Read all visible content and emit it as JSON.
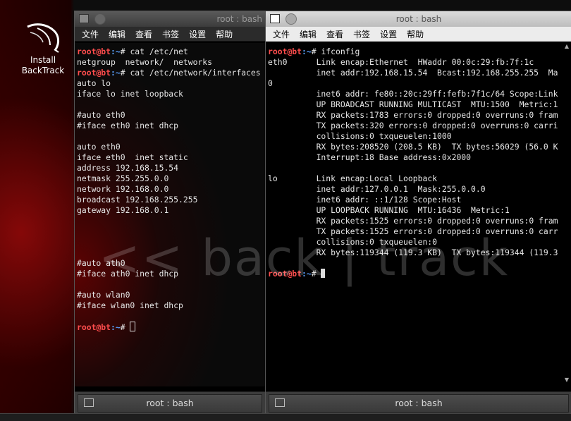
{
  "desktop": {
    "icon_label_1": "Install",
    "icon_label_2": "BackTrack",
    "watermark": "<< back | track"
  },
  "left_terminal": {
    "title": "root : bash",
    "menu": [
      "文件",
      "编辑",
      "查看",
      "书签",
      "设置",
      "帮助"
    ],
    "tab_label": "root : bash",
    "prompt_user": "root",
    "prompt_host": "@bt",
    "prompt_path": ":~",
    "prompt_symbol": "# ",
    "lines": [
      {
        "type": "prompt",
        "cmd": "cat /etc/net"
      },
      {
        "type": "out",
        "text": "netgroup  network/  networks"
      },
      {
        "type": "prompt",
        "cmd": "cat /etc/network/interfaces"
      },
      {
        "type": "out",
        "text": "auto lo"
      },
      {
        "type": "out",
        "text": "iface lo inet loopback"
      },
      {
        "type": "out",
        "text": ""
      },
      {
        "type": "out",
        "text": "#auto eth0"
      },
      {
        "type": "out",
        "text": "#iface eth0 inet dhcp"
      },
      {
        "type": "out",
        "text": ""
      },
      {
        "type": "out",
        "text": "auto eth0"
      },
      {
        "type": "out",
        "text": "iface eth0  inet static"
      },
      {
        "type": "out",
        "text": "address 192.168.15.54"
      },
      {
        "type": "out",
        "text": "netmask 255.255.0.0"
      },
      {
        "type": "out",
        "text": "network 192.168.0.0"
      },
      {
        "type": "out",
        "text": "broadcast 192.168.255.255"
      },
      {
        "type": "out",
        "text": "gateway 192.168.0.1"
      },
      {
        "type": "out",
        "text": ""
      },
      {
        "type": "out",
        "text": ""
      },
      {
        "type": "out",
        "text": ""
      },
      {
        "type": "out",
        "text": ""
      },
      {
        "type": "out",
        "text": "#auto ath0"
      },
      {
        "type": "out",
        "text": "#iface ath0 inet dhcp"
      },
      {
        "type": "out",
        "text": ""
      },
      {
        "type": "out",
        "text": "#auto wlan0"
      },
      {
        "type": "out",
        "text": "#iface wlan0 inet dhcp"
      },
      {
        "type": "out",
        "text": ""
      },
      {
        "type": "prompt_cursor",
        "cmd": ""
      }
    ]
  },
  "right_terminal": {
    "title": "root : bash",
    "menu": [
      "文件",
      "编辑",
      "查看",
      "书签",
      "设置",
      "帮助"
    ],
    "tab_label": "root : bash",
    "prompt_user": "root",
    "prompt_host": "@bt",
    "prompt_path": ":~",
    "prompt_symbol": "# ",
    "lines": [
      {
        "type": "prompt",
        "cmd": "ifconfig"
      },
      {
        "type": "out",
        "text": "eth0      Link encap:Ethernet  HWaddr 00:0c:29:fb:7f:1c"
      },
      {
        "type": "out",
        "text": "          inet addr:192.168.15.54  Bcast:192.168.255.255  Ma"
      },
      {
        "type": "out",
        "text": "0"
      },
      {
        "type": "out",
        "text": "          inet6 addr: fe80::20c:29ff:fefb:7f1c/64 Scope:Link"
      },
      {
        "type": "out",
        "text": "          UP BROADCAST RUNNING MULTICAST  MTU:1500  Metric:1"
      },
      {
        "type": "out",
        "text": "          RX packets:1783 errors:0 dropped:0 overruns:0 fram"
      },
      {
        "type": "out",
        "text": "          TX packets:320 errors:0 dropped:0 overruns:0 carri"
      },
      {
        "type": "out",
        "text": "          collisions:0 txqueuelen:1000"
      },
      {
        "type": "out",
        "text": "          RX bytes:208520 (208.5 KB)  TX bytes:56029 (56.0 K"
      },
      {
        "type": "out",
        "text": "          Interrupt:18 Base address:0x2000"
      },
      {
        "type": "out",
        "text": ""
      },
      {
        "type": "out",
        "text": "lo        Link encap:Local Loopback"
      },
      {
        "type": "out",
        "text": "          inet addr:127.0.0.1  Mask:255.0.0.0"
      },
      {
        "type": "out",
        "text": "          inet6 addr: ::1/128 Scope:Host"
      },
      {
        "type": "out",
        "text": "          UP LOOPBACK RUNNING  MTU:16436  Metric:1"
      },
      {
        "type": "out",
        "text": "          RX packets:1525 errors:0 dropped:0 overruns:0 fram"
      },
      {
        "type": "out",
        "text": "          TX packets:1525 errors:0 dropped:0 overruns:0 carr"
      },
      {
        "type": "out",
        "text": "          collisions:0 txqueuelen:0"
      },
      {
        "type": "out",
        "text": "          RX bytes:119344 (119.3 KB)  TX bytes:119344 (119.3"
      },
      {
        "type": "out",
        "text": ""
      },
      {
        "type": "prompt_cursor",
        "cmd": ""
      }
    ]
  }
}
